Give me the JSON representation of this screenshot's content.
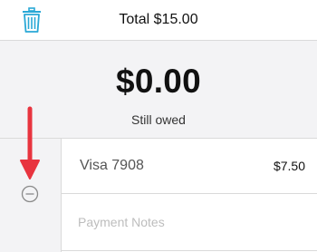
{
  "header": {
    "title": "Total $15.00",
    "delete_icon": "trash-icon"
  },
  "summary": {
    "amount": "$0.00",
    "label": "Still owed"
  },
  "payments": [
    {
      "card_label": "Visa 7908",
      "amount": "$7.50",
      "remove_icon": "minus-circle-icon"
    }
  ],
  "notes": {
    "placeholder": "Payment Notes",
    "value": ""
  },
  "annotation": {
    "arrow_color": "#e8343f"
  },
  "colors": {
    "accent": "#29a8d6"
  }
}
